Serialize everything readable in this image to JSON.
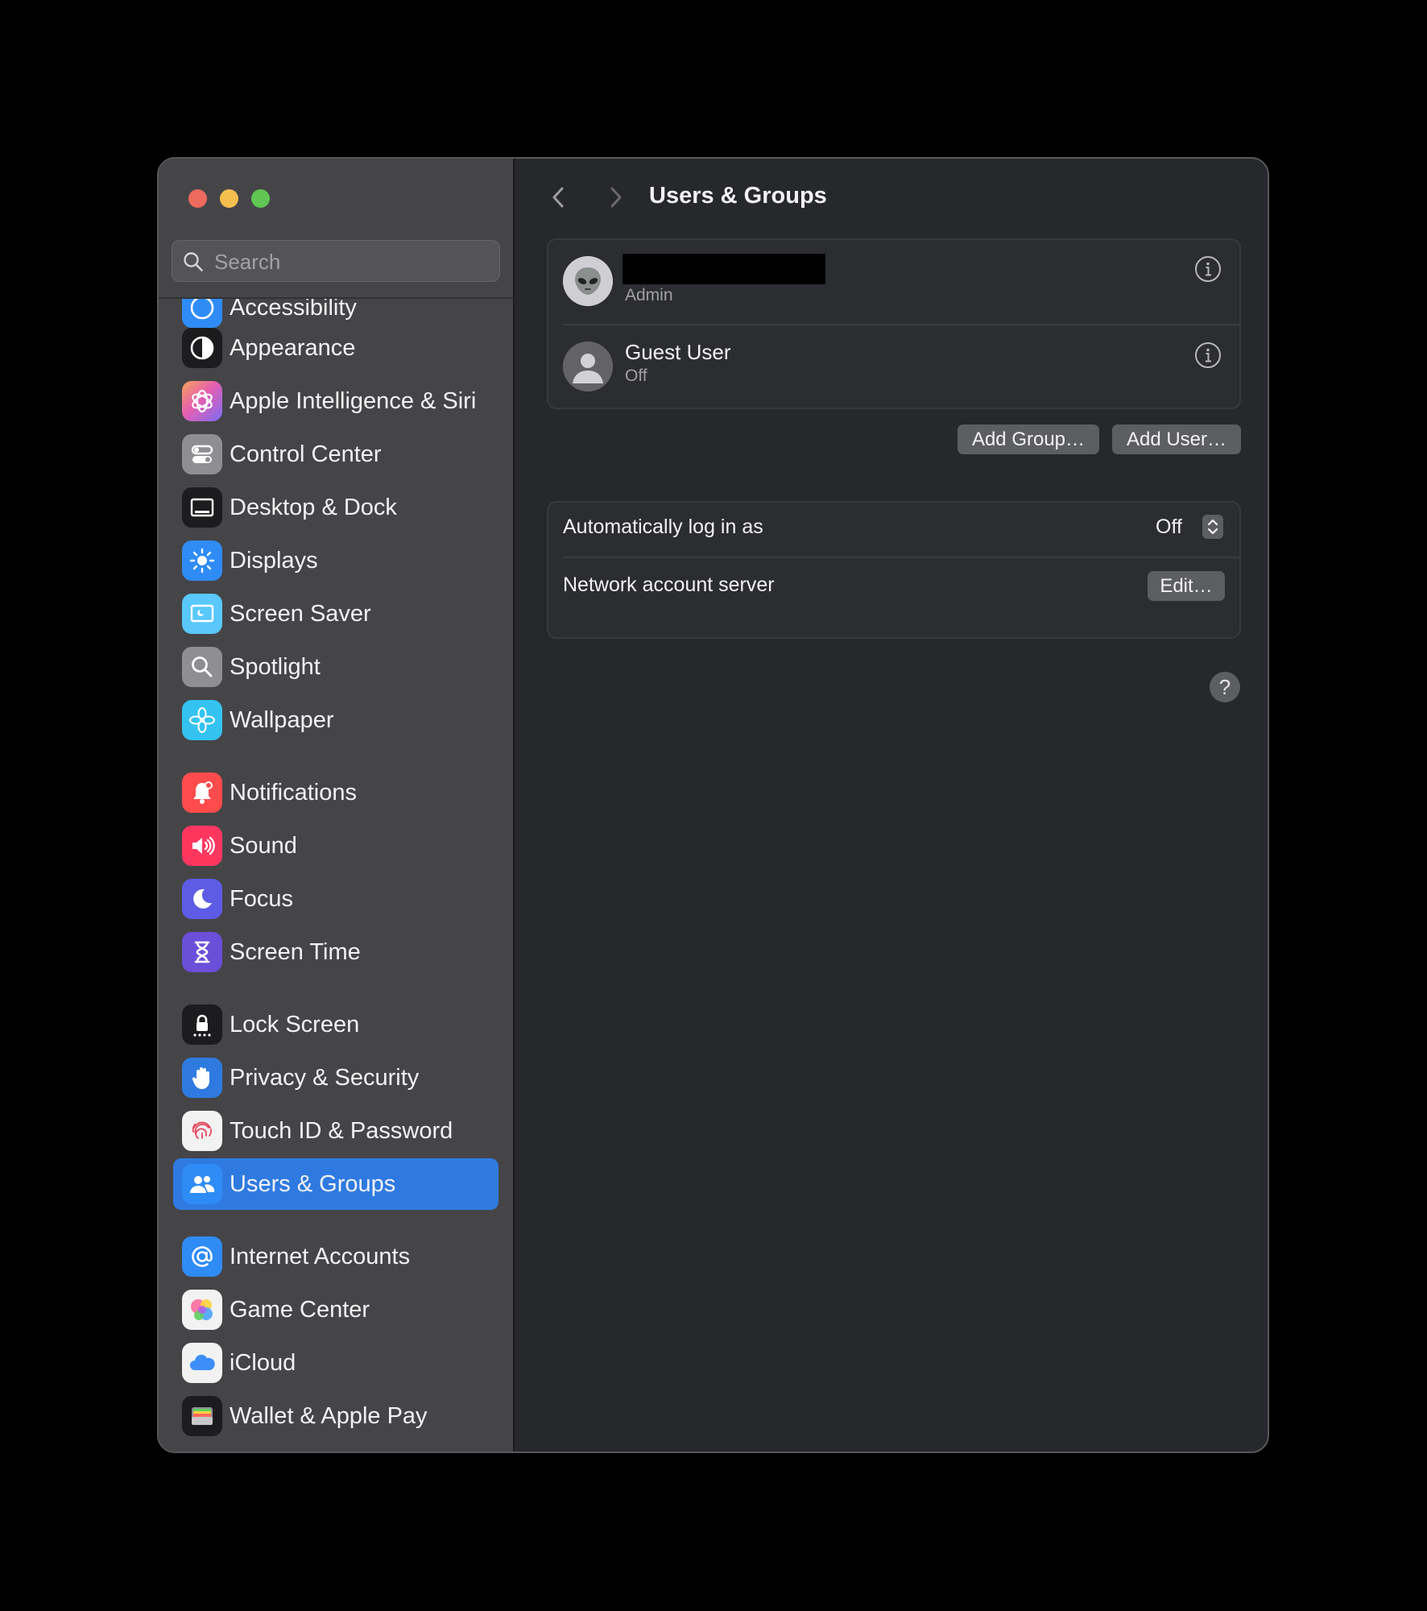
{
  "window": {
    "title": "Users & Groups"
  },
  "search": {
    "placeholder": "Search"
  },
  "sidebar": {
    "partial_item": {
      "label": "Accessibility",
      "icon": "accessibility-icon"
    },
    "items": [
      {
        "label": "Appearance",
        "icon": "appearance-icon",
        "color": "#1c1c1e"
      },
      {
        "label": "Apple Intelligence & Siri",
        "icon": "apple-intelligence-icon",
        "color": "#e87ad9"
      },
      {
        "label": "Control Center",
        "icon": "control-center-icon",
        "color": "#8e8e93"
      },
      {
        "label": "Desktop & Dock",
        "icon": "desktop-dock-icon",
        "color": "#1c1c1e"
      },
      {
        "label": "Displays",
        "icon": "displays-icon",
        "color": "#2f8cf6"
      },
      {
        "label": "Screen Saver",
        "icon": "screen-saver-icon",
        "color": "#5ac8fa"
      },
      {
        "label": "Spotlight",
        "icon": "spotlight-icon",
        "color": "#8e8e93"
      },
      {
        "label": "Wallpaper",
        "icon": "wallpaper-icon",
        "color": "#34c3f0"
      },
      {
        "label": "Notifications",
        "icon": "notifications-icon",
        "color": "#ff4b4b"
      },
      {
        "label": "Sound",
        "icon": "sound-icon",
        "color": "#ff375f"
      },
      {
        "label": "Focus",
        "icon": "focus-icon",
        "color": "#5e5ce6"
      },
      {
        "label": "Screen Time",
        "icon": "screen-time-icon",
        "color": "#6a4fd8"
      },
      {
        "label": "Lock Screen",
        "icon": "lock-screen-icon",
        "color": "#1c1c1e"
      },
      {
        "label": "Privacy & Security",
        "icon": "privacy-hand-icon",
        "color": "#2f7ae1"
      },
      {
        "label": "Touch ID & Password",
        "icon": "fingerprint-icon",
        "color": "#f2f2f2"
      },
      {
        "label": "Users & Groups",
        "icon": "users-icon",
        "color": "#2f8cf6",
        "selected": true
      },
      {
        "label": "Internet Accounts",
        "icon": "at-sign-icon",
        "color": "#2f8cf6"
      },
      {
        "label": "Game Center",
        "icon": "game-center-icon",
        "color": "#f2f2f2"
      },
      {
        "label": "iCloud",
        "icon": "icloud-icon",
        "color": "#f2f2f2"
      },
      {
        "label": "Wallet & Apple Pay",
        "icon": "wallet-icon",
        "color": "#1c1c1e"
      }
    ]
  },
  "users": [
    {
      "name": "",
      "role": "Admin",
      "avatar": "alien-avatar-icon",
      "name_redacted": true
    },
    {
      "name": "Guest User",
      "role": "Off",
      "avatar": "generic-user-avatar-icon"
    }
  ],
  "buttons": {
    "add_group": "Add Group…",
    "add_user": "Add User…",
    "edit": "Edit…"
  },
  "settings": {
    "auto_login_label": "Automatically log in as",
    "auto_login_value": "Off",
    "network_server_label": "Network account server"
  },
  "help": {
    "label": "?"
  }
}
